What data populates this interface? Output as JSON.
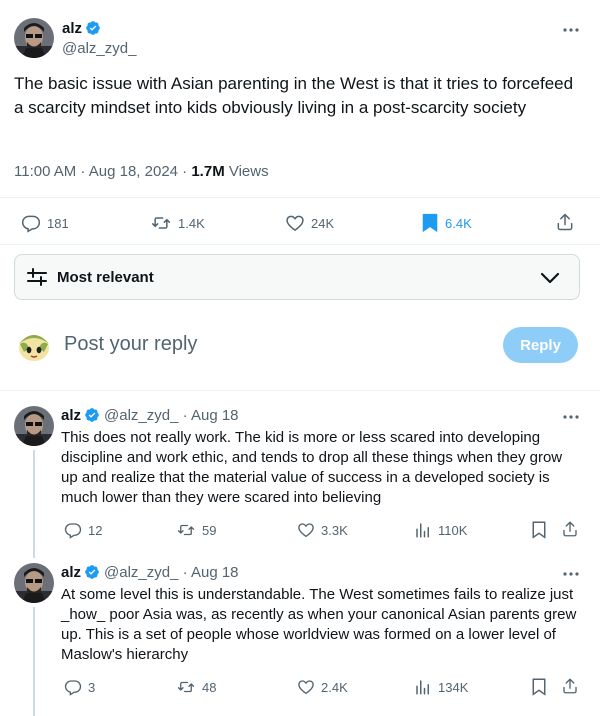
{
  "tweet": {
    "author_name": "alz",
    "author_handle": "@alz_zyd_",
    "text": "The basic issue with Asian parenting in the West is that it tries to forcefeed a scarcity mindset into kids obviously living in a post-scarcity society",
    "time": "11:00 AM · Aug 18, 2024 · ",
    "views_count": "1.7M",
    "views_label": " Views",
    "replies": "181",
    "reposts": "1.4K",
    "likes": "24K",
    "bookmarks": "6.4K"
  },
  "sort": {
    "label": "Most relevant"
  },
  "composer": {
    "placeholder": "Post your reply",
    "button": "Reply"
  },
  "replies": [
    {
      "name": "alz",
      "handle": "@alz_zyd_",
      "sep": " · ",
      "date": "Aug 18",
      "text": "This does not really work. The kid is more or less scared into developing discipline and work ethic, and tends to drop all these things when they grow up and realize that the material value of success in a developed society is much lower than they were scared into believing",
      "replies": "12",
      "reposts": "59",
      "likes": "3.3K",
      "views": "110K"
    },
    {
      "name": "alz",
      "handle": "@alz_zyd_",
      "sep": " · ",
      "date": "Aug 18",
      "text": "At some level this is understandable. The West sometimes fails to realize just _how_ poor Asia was, as recently as when your canonical Asian parents grew up. This is a set of people whose worldview was formed on a lower level of Maslow's hierarchy",
      "replies": "3",
      "reposts": "48",
      "likes": "2.4K",
      "views": "134K"
    }
  ],
  "colors": {
    "accent": "#1d9bf0",
    "muted": "#536471",
    "text": "#0f1419",
    "bookmark_active": "#1d9bf0",
    "reply_button": "#8ecdf8"
  },
  "icons": [
    "more-icon",
    "verified-icon",
    "reply-icon",
    "repost-icon",
    "like-icon",
    "bookmark-icon",
    "share-icon",
    "views-icon",
    "sort-icon",
    "chevron-down-icon"
  ]
}
